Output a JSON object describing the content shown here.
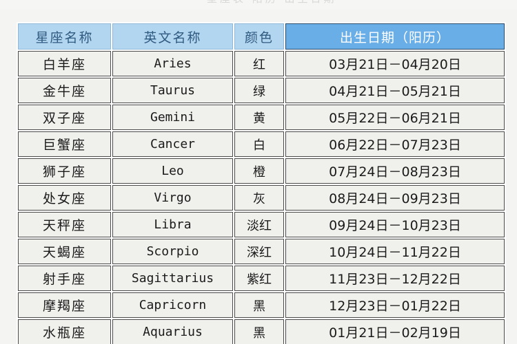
{
  "page": {
    "top_cut_text": "星座表 阳历 出生日期"
  },
  "table": {
    "headers": [
      {
        "label": "星座名称",
        "name": "header-zodiac-name"
      },
      {
        "label": "英文名称",
        "name": "header-english-name"
      },
      {
        "label": "颜色",
        "name": "header-color"
      },
      {
        "label": "出生日期（阳历）",
        "name": "header-birth-date"
      }
    ],
    "rows": [
      {
        "cn": "白羊座",
        "en": "Aries",
        "color": "红",
        "date": "03月21日－04月20日"
      },
      {
        "cn": "金牛座",
        "en": "Taurus",
        "color": "绿",
        "date": "04月21日－05月21日"
      },
      {
        "cn": "双子座",
        "en": "Gemini",
        "color": "黄",
        "date": "05月22日－06月21日"
      },
      {
        "cn": "巨蟹座",
        "en": "Cancer",
        "color": "白",
        "date": "06月22日－07月23日"
      },
      {
        "cn": "狮子座",
        "en": "Leo",
        "color": "橙",
        "date": "07月24日－08月23日"
      },
      {
        "cn": "处女座",
        "en": "Virgo",
        "color": "灰",
        "date": "08月24日－09月23日"
      },
      {
        "cn": "天秤座",
        "en": "Libra",
        "color": "淡红",
        "date": "09月24日－10月23日"
      },
      {
        "cn": "天蝎座",
        "en": "Scorpio",
        "color": "深红",
        "date": "10月24日－11月22日"
      },
      {
        "cn": "射手座",
        "en": "Sagittarius",
        "color": "紫红",
        "date": "11月23日－12月22日"
      },
      {
        "cn": "摩羯座",
        "en": "Capricorn",
        "color": "黑",
        "date": "12月23日－01月22日"
      },
      {
        "cn": "水瓶座",
        "en": "Aquarius",
        "color": "黑",
        "date": "01月21日－02月19日"
      }
    ]
  },
  "colors": {
    "header_light_blue": "#b3d6f0",
    "header_date_blue": "#6aaee8",
    "cell_background": "#f0f0ec",
    "grid_line": "#4a4a4a",
    "page_background": "#f4f4f2"
  }
}
